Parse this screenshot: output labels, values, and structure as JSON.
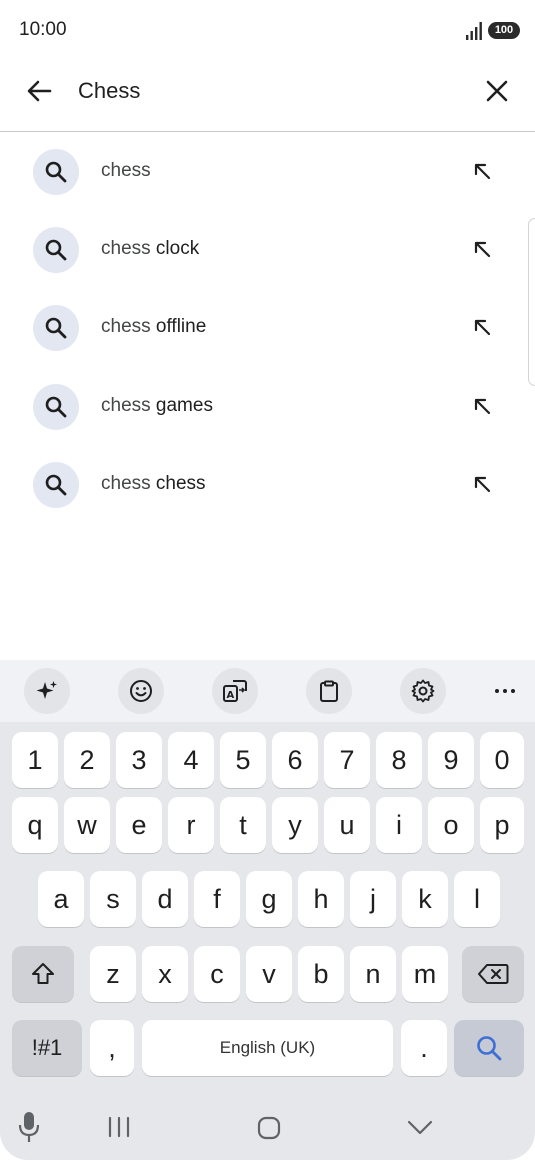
{
  "status_bar": {
    "time": "10:00",
    "battery": "100",
    "signal_icon": "signal-bars-icon"
  },
  "search": {
    "query": "Chess",
    "back_icon": "arrow-left-icon",
    "clear_icon": "close-icon"
  },
  "suggestions": [
    {
      "prefix": "chess",
      "suffix": ""
    },
    {
      "prefix": "chess",
      "suffix": " clock"
    },
    {
      "prefix": "chess",
      "suffix": " offline"
    },
    {
      "prefix": "chess",
      "suffix": " games"
    },
    {
      "prefix": "chess",
      "suffix": " chess"
    }
  ],
  "keyboard": {
    "toolbar_icons": [
      "sparkle-icon",
      "emoji-icon",
      "translate-icon",
      "clipboard-icon",
      "settings-icon",
      "more-icon"
    ],
    "number_row": [
      "1",
      "2",
      "3",
      "4",
      "5",
      "6",
      "7",
      "8",
      "9",
      "0"
    ],
    "row1": [
      "q",
      "w",
      "e",
      "r",
      "t",
      "y",
      "u",
      "i",
      "o",
      "p"
    ],
    "row2": [
      "a",
      "s",
      "d",
      "f",
      "g",
      "h",
      "j",
      "k",
      "l"
    ],
    "row3": [
      "z",
      "x",
      "c",
      "v",
      "b",
      "n",
      "m"
    ],
    "symbols_label": "!#1",
    "comma_label": ",",
    "space_label": "English (UK)",
    "period_label": ".",
    "accent_color": "#3d6fd6"
  },
  "nav_bar": {
    "icons": [
      "microphone-icon",
      "recents-icon",
      "home-icon",
      "hide-keyboard-icon"
    ]
  }
}
